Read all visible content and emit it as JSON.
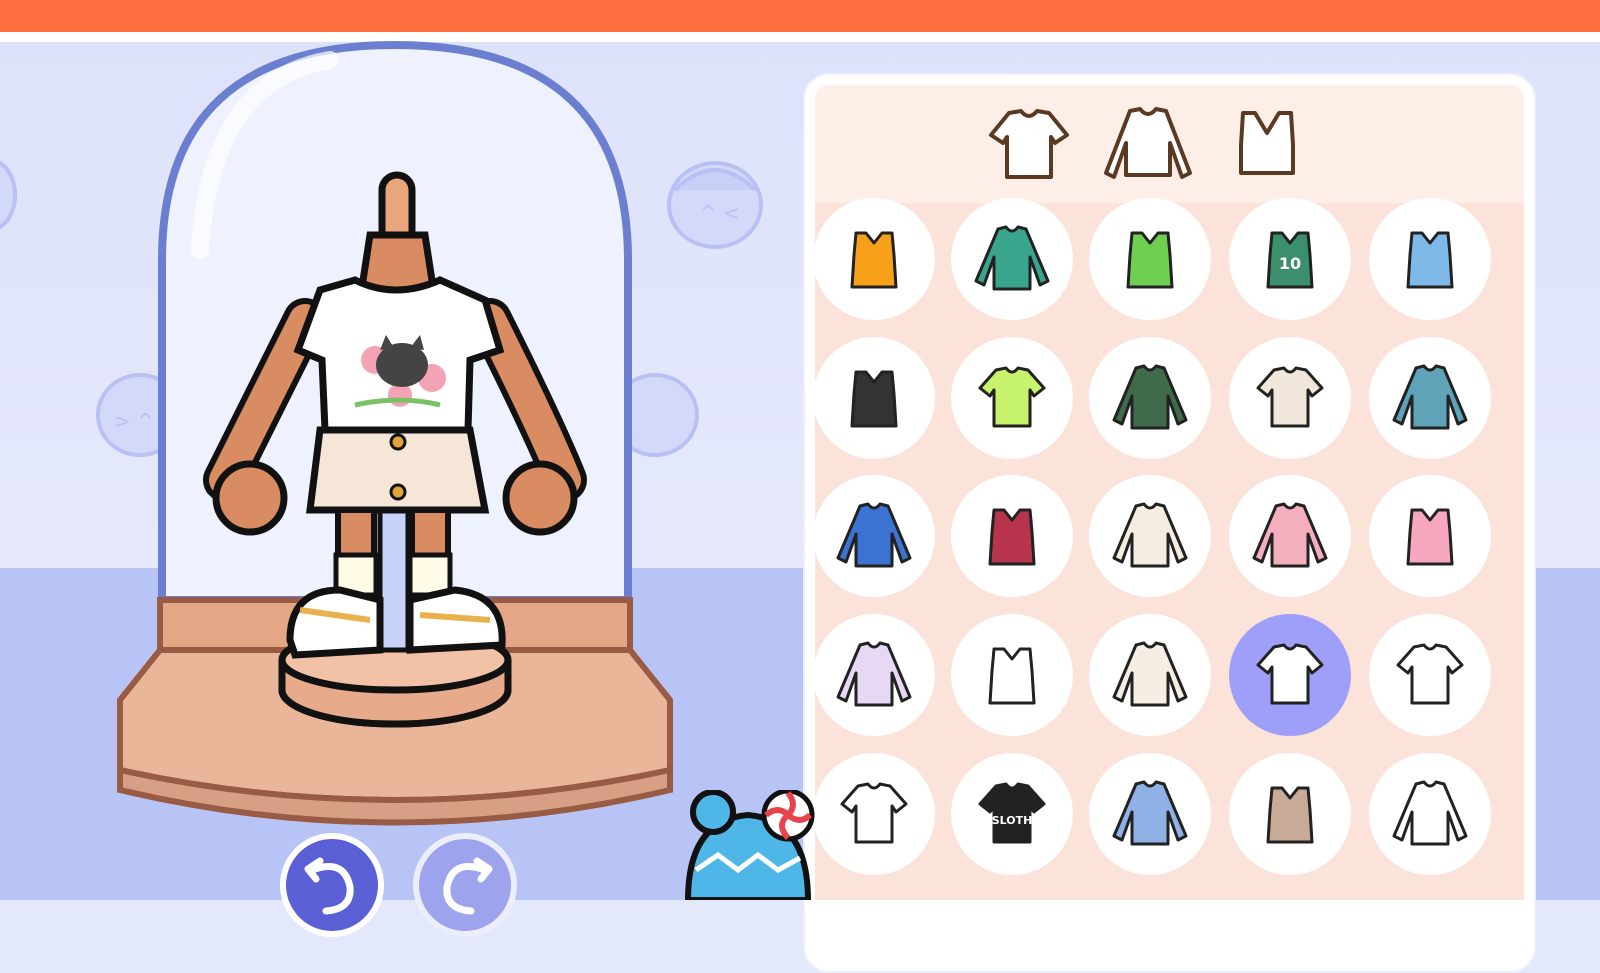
{
  "screen": "wardrobe-dressing",
  "colors": {
    "top_bar": "#ff6f3f",
    "panel_tint": "#fbe3da",
    "selected_slot": "#9e9ff8",
    "undo_button": "#5b5fd6",
    "redo_button": "#9ea3ee"
  },
  "category_tabs": [
    {
      "icon": "tshirt-outline-icon"
    },
    {
      "icon": "long-sleeve-outline-icon"
    },
    {
      "icon": "tank-top-outline-icon"
    }
  ],
  "garments": [
    {
      "icon": "orange-halter-top-icon",
      "color": "#f7a11a"
    },
    {
      "icon": "teal-vest-shirt-icon",
      "color": "#3aa58d"
    },
    {
      "icon": "green-leopard-top-icon",
      "color": "#6fcf4f"
    },
    {
      "icon": "basketball-jersey-icon",
      "color": "#3c8f6c",
      "text": "10"
    },
    {
      "icon": "blue-ruffle-crop-top-icon",
      "color": "#7fb9e8"
    },
    {
      "icon": "black-checker-crop-top-icon",
      "color": "#333333"
    },
    {
      "icon": "lime-layered-top-icon",
      "color": "#c7f26b"
    },
    {
      "icon": "striped-polo-sweater-icon",
      "color": "#3f6b4a"
    },
    {
      "icon": "slomo-print-tee-icon",
      "color": "#f0e7da"
    },
    {
      "icon": "teal-stripe-shirt-icon",
      "color": "#5fa3b8"
    },
    {
      "icon": "sunflower-hawaiian-shirt-icon",
      "color": "#3c73d2"
    },
    {
      "icon": "red-plaid-corset-icon",
      "color": "#b8344d"
    },
    {
      "icon": "cream-bow-blouse-icon",
      "color": "#f6ede2"
    },
    {
      "icon": "pink-bow-cardigan-icon",
      "color": "#f5aebd"
    },
    {
      "icon": "pink-striped-cami-icon",
      "color": "#f7a8bf"
    },
    {
      "icon": "lilac-puff-sleeve-top-icon",
      "color": "#e7d8f4"
    },
    {
      "icon": "white-tank-top-icon",
      "color": "#ffffff"
    },
    {
      "icon": "cream-turtleneck-icon",
      "color": "#f5efe3"
    },
    {
      "icon": "cat-flower-tee-icon",
      "color": "#ffffff",
      "selected": true
    },
    {
      "icon": "white-tee-icon",
      "color": "#ffffff"
    },
    {
      "icon": "white-crop-tee-icon",
      "color": "#ffffff"
    },
    {
      "icon": "black-graphic-tee-icon",
      "color": "#222222",
      "text": "SLOTH"
    },
    {
      "icon": "blue-striped-long-sleeve-icon",
      "color": "#8fb1e6"
    },
    {
      "icon": "tan-tube-top-icon",
      "color": "#c9aa96"
    },
    {
      "icon": "white-collar-shirt-icon",
      "color": "#ffffff"
    }
  ],
  "controls": {
    "undo_icon": "undo-arrow-icon",
    "redo_icon": "redo-arrow-icon"
  }
}
